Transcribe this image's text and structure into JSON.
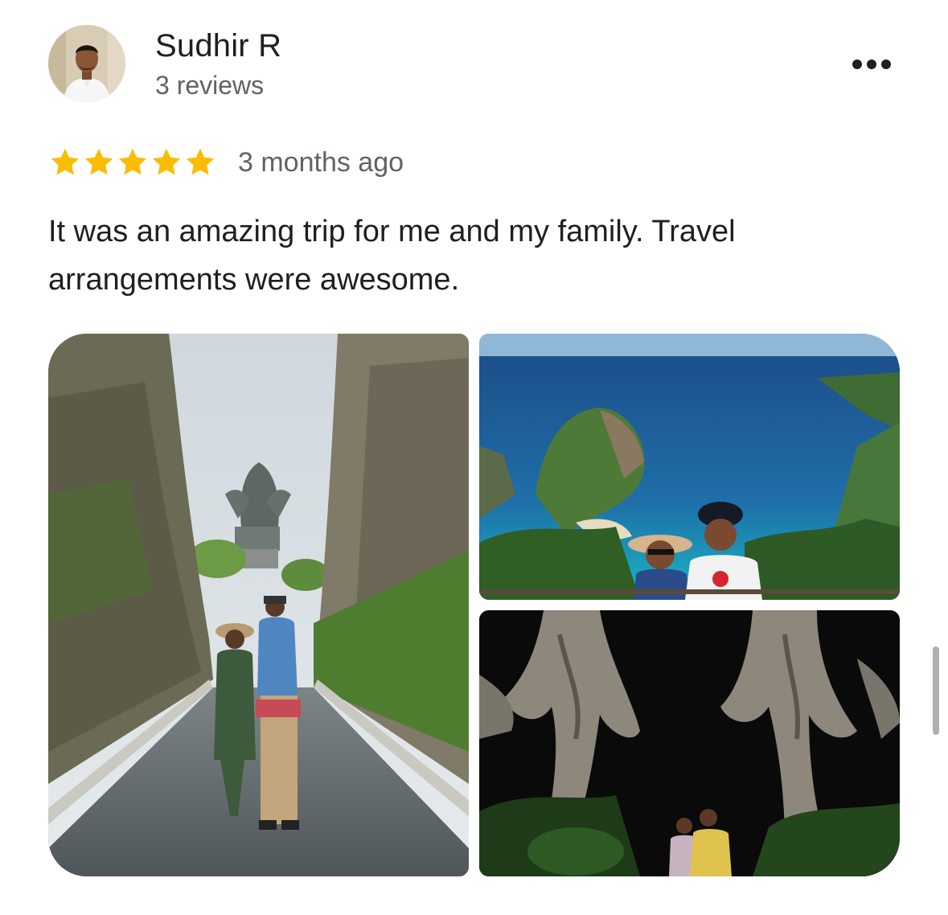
{
  "review": {
    "author_name": "Sudhir R",
    "author_reviews": "3 reviews",
    "rating": 5,
    "rating_max": 5,
    "date": "3 months ago",
    "text": "It was an amazing trip for me and my family. Travel arrangements were awesome."
  },
  "photos": [
    {
      "name": "photo-statue-canyon-couple"
    },
    {
      "name": "photo-cliff-beach-couple"
    },
    {
      "name": "photo-night-sculptures-couple"
    }
  ],
  "icons": {
    "more": "more-horizontal-icon",
    "star": "star-icon"
  },
  "colors": {
    "star": "#FBBC04",
    "text_primary": "#1f1f1f",
    "text_secondary": "#5f6368"
  }
}
